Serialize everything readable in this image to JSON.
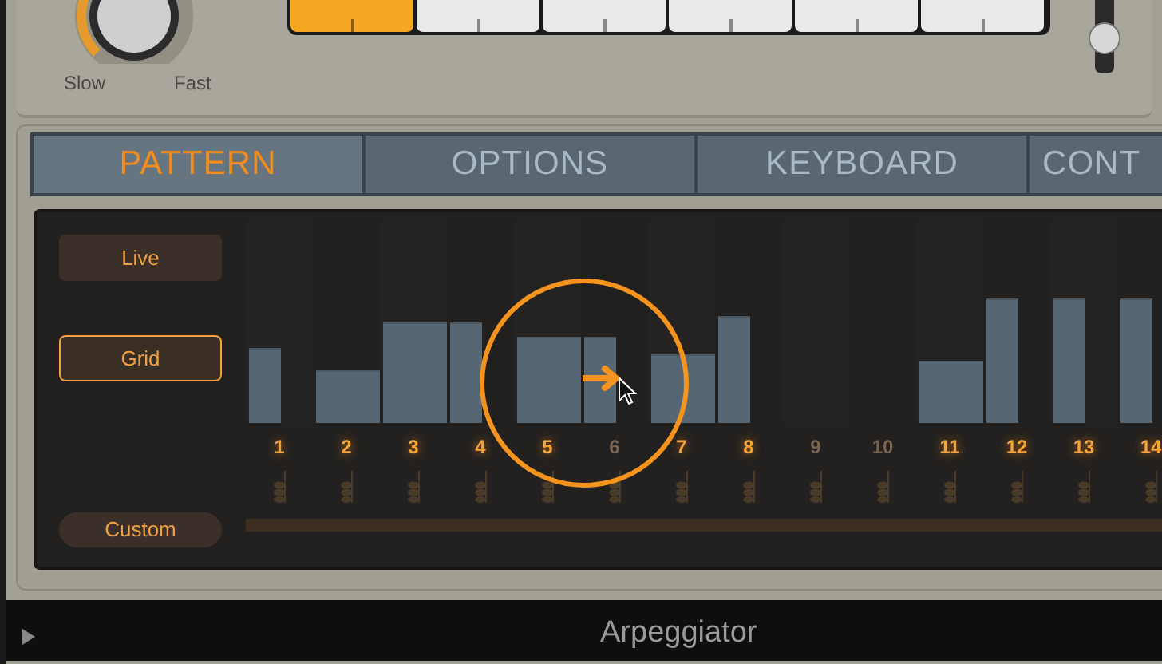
{
  "rate_knob": {
    "labels": [
      "Slow",
      "Fast"
    ]
  },
  "note_order_buttons": [
    {
      "selected": true
    },
    {
      "selected": false
    },
    {
      "selected": false
    },
    {
      "selected": false
    },
    {
      "selected": false
    },
    {
      "selected": false
    }
  ],
  "tabs": [
    {
      "label": "PATTERN",
      "selected": true
    },
    {
      "label": "OPTIONS",
      "selected": false
    },
    {
      "label": "KEYBOARD",
      "selected": false
    },
    {
      "label": "CONT",
      "selected": false
    }
  ],
  "modes": [
    {
      "label": "Live",
      "selected": false,
      "kind": "box"
    },
    {
      "label": "Grid",
      "selected": true,
      "kind": "box"
    },
    {
      "label": "Custom",
      "selected": false,
      "kind": "pill"
    }
  ],
  "steps": [
    {
      "number": "1",
      "active": true,
      "kind": "half",
      "level": 0.37
    },
    {
      "number": "2",
      "active": true,
      "kind": "full",
      "level": 0.26
    },
    {
      "number": "3",
      "active": true,
      "kind": "tied",
      "level": 0.5
    },
    {
      "number": "4",
      "active": true,
      "kind": "half",
      "level": 0.5
    },
    {
      "number": "5",
      "active": true,
      "kind": "tied",
      "level": 0.43
    },
    {
      "number": "6",
      "active": false,
      "kind": "half",
      "level": 0.43
    },
    {
      "number": "7",
      "active": true,
      "kind": "full",
      "level": 0.34
    },
    {
      "number": "8",
      "active": true,
      "kind": "half",
      "level": 0.53
    },
    {
      "number": "9",
      "active": false,
      "kind": "rest"
    },
    {
      "number": "10",
      "active": false,
      "kind": "rest"
    },
    {
      "number": "11",
      "active": true,
      "kind": "full",
      "level": 0.31
    },
    {
      "number": "12",
      "active": true,
      "kind": "half",
      "level": 0.62
    },
    {
      "number": "13",
      "active": true,
      "kind": "half",
      "level": 0.62
    },
    {
      "number": "14",
      "active": true,
      "kind": "half",
      "level": 0.62
    }
  ],
  "footer": {
    "title": "Arpeggiator"
  }
}
